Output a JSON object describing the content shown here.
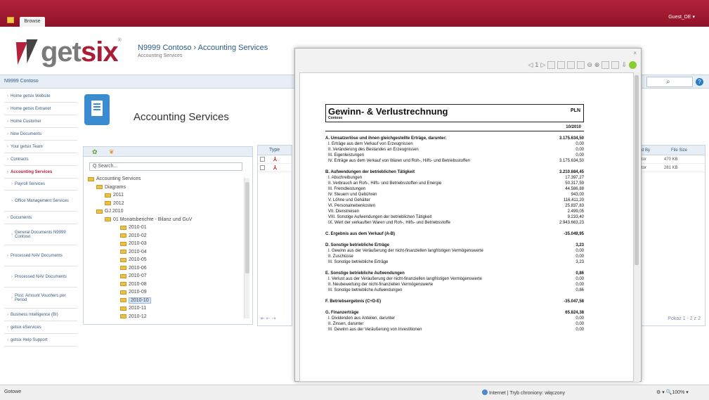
{
  "topbar": {
    "tab": "Browse",
    "user": "Guest_DE ▾"
  },
  "header": {
    "brand_a": "get",
    "brand_b": "six",
    "reg": "®",
    "crumb_site": "N9999 Contoso",
    "crumb_sep": "›",
    "crumb_page": "Accounting Services",
    "crumb_sub": "Accounting Services"
  },
  "sitebar": {
    "site": "N9999 Contoso"
  },
  "nav": [
    {
      "label": "Home getsix Website",
      "sub": false,
      "active": false
    },
    {
      "label": "Home getsix Extranet",
      "sub": false,
      "active": false
    },
    {
      "label": "Home Customer",
      "sub": false,
      "active": false
    },
    {
      "label": "New Documents",
      "sub": false,
      "active": false
    },
    {
      "label": "Your getsix Team",
      "sub": false,
      "active": false
    },
    {
      "label": "Contracts",
      "sub": false,
      "active": false
    },
    {
      "label": "Accounting Services",
      "sub": false,
      "active": true
    },
    {
      "label": "Payroll Services",
      "sub": true,
      "active": false
    },
    {
      "label": "Office Management Services",
      "sub": true,
      "active": false
    },
    {
      "label": "Documents",
      "sub": false,
      "active": false
    },
    {
      "label": "General Documents N9999 Contoso",
      "sub": true,
      "active": false
    },
    {
      "label": "Processed NAV Documents",
      "sub": false,
      "active": false
    },
    {
      "label": "Processed NAV Documents",
      "sub": true,
      "active": false
    },
    {
      "label": "Post. Amount Vouchers per Period",
      "sub": true,
      "active": false
    },
    {
      "label": "Business Intelligence (BI)",
      "sub": false,
      "active": false
    },
    {
      "label": "getsix eServices",
      "sub": false,
      "active": false
    },
    {
      "label": "getsix Help Support",
      "sub": false,
      "active": false
    }
  ],
  "main": {
    "title": "Accounting Services",
    "search_placeholder": "Q Search..."
  },
  "tree": [
    {
      "label": "Accounting Services",
      "depth": 0,
      "sel": false
    },
    {
      "label": "Diagrams",
      "depth": 1,
      "sel": false
    },
    {
      "label": "2011",
      "depth": 2,
      "sel": false
    },
    {
      "label": "2012",
      "depth": 2,
      "sel": false
    },
    {
      "label": "GJ 2010",
      "depth": 1,
      "sel": false
    },
    {
      "label": "01 Monatsberichte - Bilanz und GuV",
      "depth": 2,
      "sel": false
    },
    {
      "label": "2010-01",
      "depth": 3,
      "sel": false
    },
    {
      "label": "2010-02",
      "depth": 3,
      "sel": false
    },
    {
      "label": "2010-03",
      "depth": 3,
      "sel": false
    },
    {
      "label": "2010-04",
      "depth": 3,
      "sel": false
    },
    {
      "label": "2010-05",
      "depth": 3,
      "sel": false
    },
    {
      "label": "2010-06",
      "depth": 3,
      "sel": false
    },
    {
      "label": "2010-07",
      "depth": 3,
      "sel": false
    },
    {
      "label": "2010-08",
      "depth": 3,
      "sel": false
    },
    {
      "label": "2010-09",
      "depth": 3,
      "sel": false
    },
    {
      "label": "2010-10",
      "depth": 3,
      "sel": true
    },
    {
      "label": "2010-11",
      "depth": 3,
      "sel": false
    },
    {
      "label": "2010-12",
      "depth": 3,
      "sel": false
    }
  ],
  "docs": {
    "col_type": "Type"
  },
  "rightcols": {
    "col_by": "d By",
    "col_size": "File Size",
    "rows": [
      {
        "by": "tor",
        "size": "470 KB"
      },
      {
        "by": "tor",
        "size": "281 KB"
      }
    ],
    "pager": "Pokaż 1 - 2 z 2"
  },
  "report": {
    "title": "Gewinn- & Verlustrechnung",
    "company": "Contoso",
    "currency": "PLN",
    "period": "10/2010",
    "lines": [
      {
        "t": "A. Umsatzerlöse und ihnen gleichgestellte Erträge, darunter:",
        "v": "3.175.634,50",
        "b": true,
        "gap": false
      },
      {
        "t": "I. Erträge aus dem Verkauf von Erzeugnissen",
        "v": "0,00",
        "b": false,
        "gap": false
      },
      {
        "t": "II. Veränderung des Bestandes an Erzeugnissen",
        "v": "0,00",
        "b": false,
        "gap": false
      },
      {
        "t": "III. Eigenleistungen",
        "v": "0,00",
        "b": false,
        "gap": false
      },
      {
        "t": "IV. Erträge aus dem Verkauf von Waren und Roh-, Hilfs- und Betriebsstoffen",
        "v": "3.175.634,50",
        "b": false,
        "gap": false
      },
      {
        "t": "B. Aufwendungen der betrieblichen Tätigkeit",
        "v": "3.210.684,45",
        "b": true,
        "gap": true
      },
      {
        "t": "I. Abschreibungen",
        "v": "17.397,27",
        "b": false,
        "gap": false
      },
      {
        "t": "II. Verbrauch an Roh-, Hilfs- und Betriebsstoffen und Energie",
        "v": "50.317,59",
        "b": false,
        "gap": false
      },
      {
        "t": "III. Fremdleistungen",
        "v": "44.586,88",
        "b": false,
        "gap": false
      },
      {
        "t": "IV. Steuern und Gebühren",
        "v": "943,00",
        "b": false,
        "gap": false
      },
      {
        "t": "V. Löhne und Gehälter",
        "v": "116.411,20",
        "b": false,
        "gap": false
      },
      {
        "t": "VI. Personalnebenkosten",
        "v": "25.837,83",
        "b": false,
        "gap": false
      },
      {
        "t": "VII. Dienstreisen",
        "v": "2.499,05",
        "b": false,
        "gap": false
      },
      {
        "t": "VIII. Sonstige Aufwendungen der betrieblichen Tätigkeit",
        "v": "9.233,40",
        "b": false,
        "gap": false
      },
      {
        "t": "IX. Wert der verkauften Waren und Roh-, Hilfs- und Betriebsstoffe",
        "v": "2.943.663,23",
        "b": false,
        "gap": false
      },
      {
        "t": "C. Ergebnis aus dem Verkauf (A-B)",
        "v": "-35.049,95",
        "b": true,
        "gap": true
      },
      {
        "t": "D. Sonstige betriebliche Erträge",
        "v": "3,23",
        "b": true,
        "gap": true
      },
      {
        "t": "I. Gewinn aus der Veräußerung der nicht-finanziellen langfristigen Vermögenswerte",
        "v": "0,00",
        "b": false,
        "gap": false
      },
      {
        "t": "II. Zuschüsse",
        "v": "0,00",
        "b": false,
        "gap": false
      },
      {
        "t": "III. Sonstige betriebliche Erträge",
        "v": "3,23",
        "b": false,
        "gap": false
      },
      {
        "t": "E. Sonstige betriebliche Aufwendungen",
        "v": "0,86",
        "b": true,
        "gap": true
      },
      {
        "t": "I. Verlust aus der Veräußerung der nicht-finanziellen langfristigen Vermögenswerte",
        "v": "0,00",
        "b": false,
        "gap": false
      },
      {
        "t": "II. Neubewertung der nicht-finanziellen Vermögenswerte",
        "v": "0,00",
        "b": false,
        "gap": false
      },
      {
        "t": "III. Sonstige betriebliche Aufwendungen",
        "v": "0,86",
        "b": false,
        "gap": false
      },
      {
        "t": "F. Betriebsergebnis (C+D-E)",
        "v": "-35.047,58",
        "b": true,
        "gap": true
      },
      {
        "t": "G. Finanzerträge",
        "v": "65.824,38",
        "b": true,
        "gap": true
      },
      {
        "t": "I. Dividenden aus Anteilen, darunter",
        "v": "0,00",
        "b": false,
        "gap": false
      },
      {
        "t": "II. Zinsen, darunter",
        "v": "0,00",
        "b": false,
        "gap": false
      },
      {
        "t": "III. Gewinn aus der Veräußerung von Investitionen",
        "v": "0,00",
        "b": false,
        "gap": false
      }
    ]
  },
  "status": {
    "left": "Gotowe",
    "zone": "Internet | Tryb chroniony: włączony",
    "zoom": "⚙ ▾  🔍100% ▾"
  }
}
